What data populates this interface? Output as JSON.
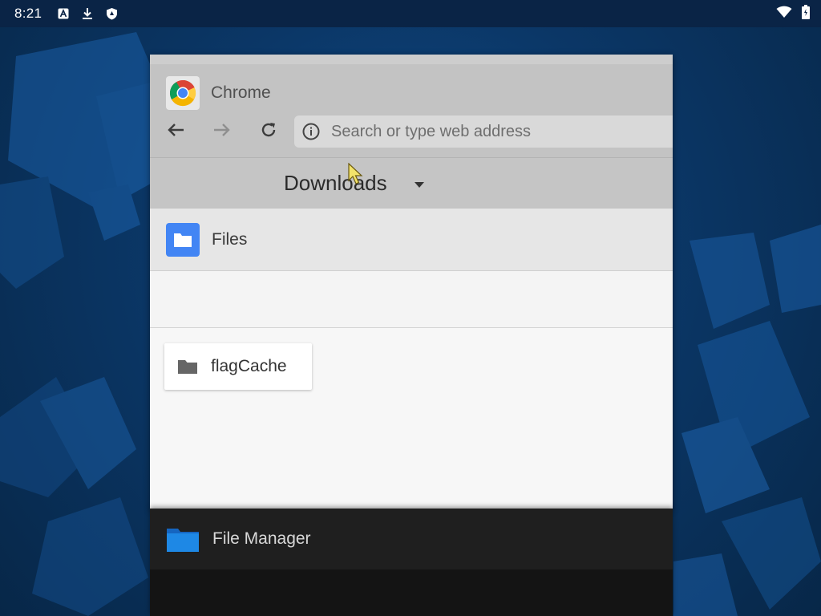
{
  "status_bar": {
    "time": "8:21",
    "left_icons": [
      "app-a-icon",
      "download-icon",
      "shield-icon"
    ],
    "right_icons": [
      "wifi-icon",
      "battery-icon"
    ]
  },
  "recents": {
    "chrome_card": {
      "app_title": "Chrome",
      "toolbar": {
        "back_icon": "arrow-left-icon",
        "forward_icon": "arrow-right-icon",
        "reload_icon": "reload-icon",
        "omnibox_placeholder": "Search or type web address"
      },
      "page": {
        "title": "Downloads",
        "dropdown_icon": "dropdown-triangle-icon",
        "source_row_label": "Files",
        "items": [
          {
            "label": "flagCache",
            "icon": "folder-icon"
          }
        ]
      }
    },
    "file_manager_card": {
      "app_title": "File Manager"
    }
  },
  "colors": {
    "wallpaper": "#0b3767",
    "files_icon_blue": "#4285f4",
    "folder_blue": "#1e88e5"
  }
}
